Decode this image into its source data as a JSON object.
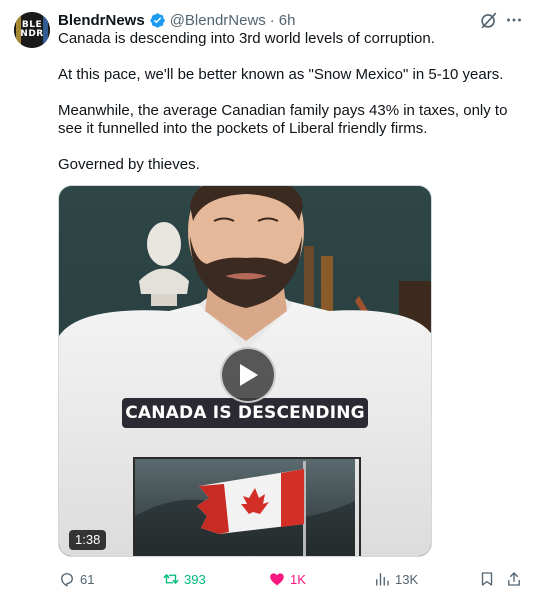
{
  "tweet": {
    "avatar": {
      "text_line1": "BLE",
      "text_line2": "NDR"
    },
    "display_name": "BlendrNews",
    "handle": "@BlendrNews",
    "separator": "·",
    "time": "6h",
    "paragraphs": [
      "Canada is descending into 3rd world levels of corruption.",
      "At this pace, we'll be better known as \"Snow Mexico\" in 5-10 years.",
      "Meanwhile, the average Canadian family pays 43% in taxes, only to see it funnelled into the pockets of Liberal friendly firms.",
      "Governed by thieves."
    ],
    "media": {
      "caption": "CANADA IS DESCENDING",
      "duration": "1:38"
    },
    "actions": {
      "replies": "61",
      "retweets": "393",
      "likes": "1K",
      "views": "13K"
    },
    "colors": {
      "verified": "#1d9bf0",
      "retweet_active": "#00ba7c",
      "like_active": "#f91880",
      "secondary_text": "#536471"
    }
  }
}
